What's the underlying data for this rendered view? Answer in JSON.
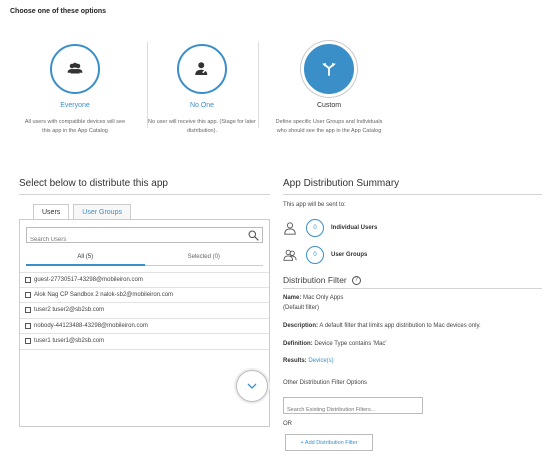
{
  "header": {
    "title": "Choose one of these options"
  },
  "options": [
    {
      "label": "Everyone",
      "description": "All users with compatible devices will see this app in the App Catalog",
      "icon": "group-icon"
    },
    {
      "label": "No One",
      "description": "No user will receive this app. (Stage for later distribution).",
      "icon": "user-blocked-icon"
    },
    {
      "label": "Custom",
      "description": "Define specific User Groups and Individuals who should see the app in the App Catalog",
      "icon": "split-arrow-icon",
      "selected": true
    }
  ],
  "distribute": {
    "title": "Select below to distribute this app",
    "tabs": [
      "Users",
      "User Groups"
    ],
    "search_placeholder": "Search Users",
    "subtabs": [
      "All (5)",
      "Selected (0)"
    ],
    "users": [
      "guest-27730517-43298@mobileiron.com",
      "Alok Nag CP Sandbox 2 nalok-sb2@mobileiron.com",
      "tuser2 tuser2@sb2sb.com",
      "nobody-44123488-43298@mobileiron.com",
      "tuser1 tuser1@sb2sb.com"
    ]
  },
  "summary": {
    "title": "App Distribution Summary",
    "subtitle": "This app will be sent to:",
    "rows": [
      {
        "count": "0",
        "label": "Individual Users"
      },
      {
        "count": "0",
        "label": "User Groups"
      }
    ]
  },
  "filter": {
    "title": "Distribution Filter",
    "help": "?",
    "name_label": "Name:",
    "name_value": "Mac Only Apps",
    "name_note": "(Default filter)",
    "description_label": "Description:",
    "description_value": "A default filter that limits app distribution to Mac devices only.",
    "definition_label": "Definition:",
    "definition_value": "Device Type contains 'Mac'",
    "results_label": "Results:",
    "results_value": "Device(s)",
    "other_label": "Other Distribution Filter Options",
    "search_placeholder": "Search Existing Distribution Filters...",
    "or_label": "OR",
    "add_button": "+ Add Distribution Filter"
  },
  "colors": {
    "accent": "#3b8fc9"
  }
}
